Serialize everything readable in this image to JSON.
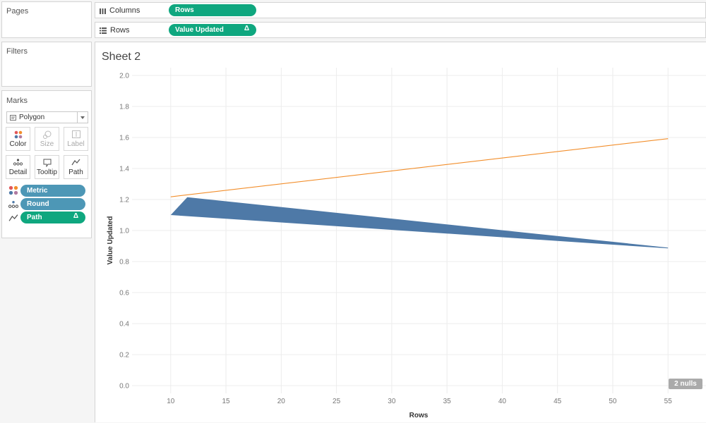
{
  "left_panel": {
    "pages_title": "Pages",
    "filters_title": "Filters",
    "marks_title": "Marks",
    "mark_type": "Polygon",
    "buttons": [
      {
        "label": "Color",
        "icon": "color-dots-icon",
        "enabled": true
      },
      {
        "label": "Size",
        "icon": "size-icon",
        "enabled": false
      },
      {
        "label": "Label",
        "icon": "label-icon",
        "enabled": false
      },
      {
        "label": "Detail",
        "icon": "detail-dots-icon",
        "enabled": true
      },
      {
        "label": "Tooltip",
        "icon": "tooltip-icon",
        "enabled": true
      },
      {
        "label": "Path",
        "icon": "path-icon",
        "enabled": true
      }
    ],
    "encodings": [
      {
        "label": "Metric",
        "icon": "color-dots-icon",
        "pill_color": "#4d97b6",
        "delta": ""
      },
      {
        "label": "Round",
        "icon": "detail-dots-icon",
        "pill_color": "#4d97b6",
        "delta": ""
      },
      {
        "label": "Path",
        "icon": "path-icon",
        "pill_color": "#0fa77f",
        "delta": "Δ"
      }
    ]
  },
  "shelves": {
    "columns_label": "Columns",
    "columns_pill": "Rows",
    "rows_label": "Rows",
    "rows_pill": "Value Updated",
    "rows_pill_delta": "Δ"
  },
  "sheet": {
    "title": "Sheet 2",
    "nulls_badge": "2 nulls"
  },
  "chart_data": {
    "type": "area",
    "xlabel": "Rows",
    "ylabel": "Value Updated",
    "xlim": [
      6.5,
      58.5
    ],
    "ylim": [
      -0.05,
      2.05
    ],
    "x_ticks": [
      10,
      15,
      20,
      25,
      30,
      35,
      40,
      45,
      50,
      55
    ],
    "y_ticks": [
      0.0,
      0.2,
      0.4,
      0.6,
      0.8,
      1.0,
      1.2,
      1.4,
      1.6,
      1.8,
      2.0
    ],
    "y_tick_labels": [
      "0.0",
      "0.2",
      "0.4",
      "0.6",
      "0.8",
      "1.0",
      "1.2",
      "1.4",
      "1.6",
      "1.8",
      "2.0"
    ],
    "grid": true,
    "series": [
      {
        "color": "#f28e2b",
        "points": [
          [
            10,
            1.22
          ],
          [
            55,
            1.595
          ],
          [
            55,
            1.59
          ],
          [
            10,
            1.215
          ]
        ]
      },
      {
        "color": "#4e79a7",
        "points": [
          [
            10,
            1.1
          ],
          [
            11.5,
            1.215
          ],
          [
            55,
            0.89
          ],
          [
            55,
            0.885
          ]
        ]
      }
    ]
  }
}
